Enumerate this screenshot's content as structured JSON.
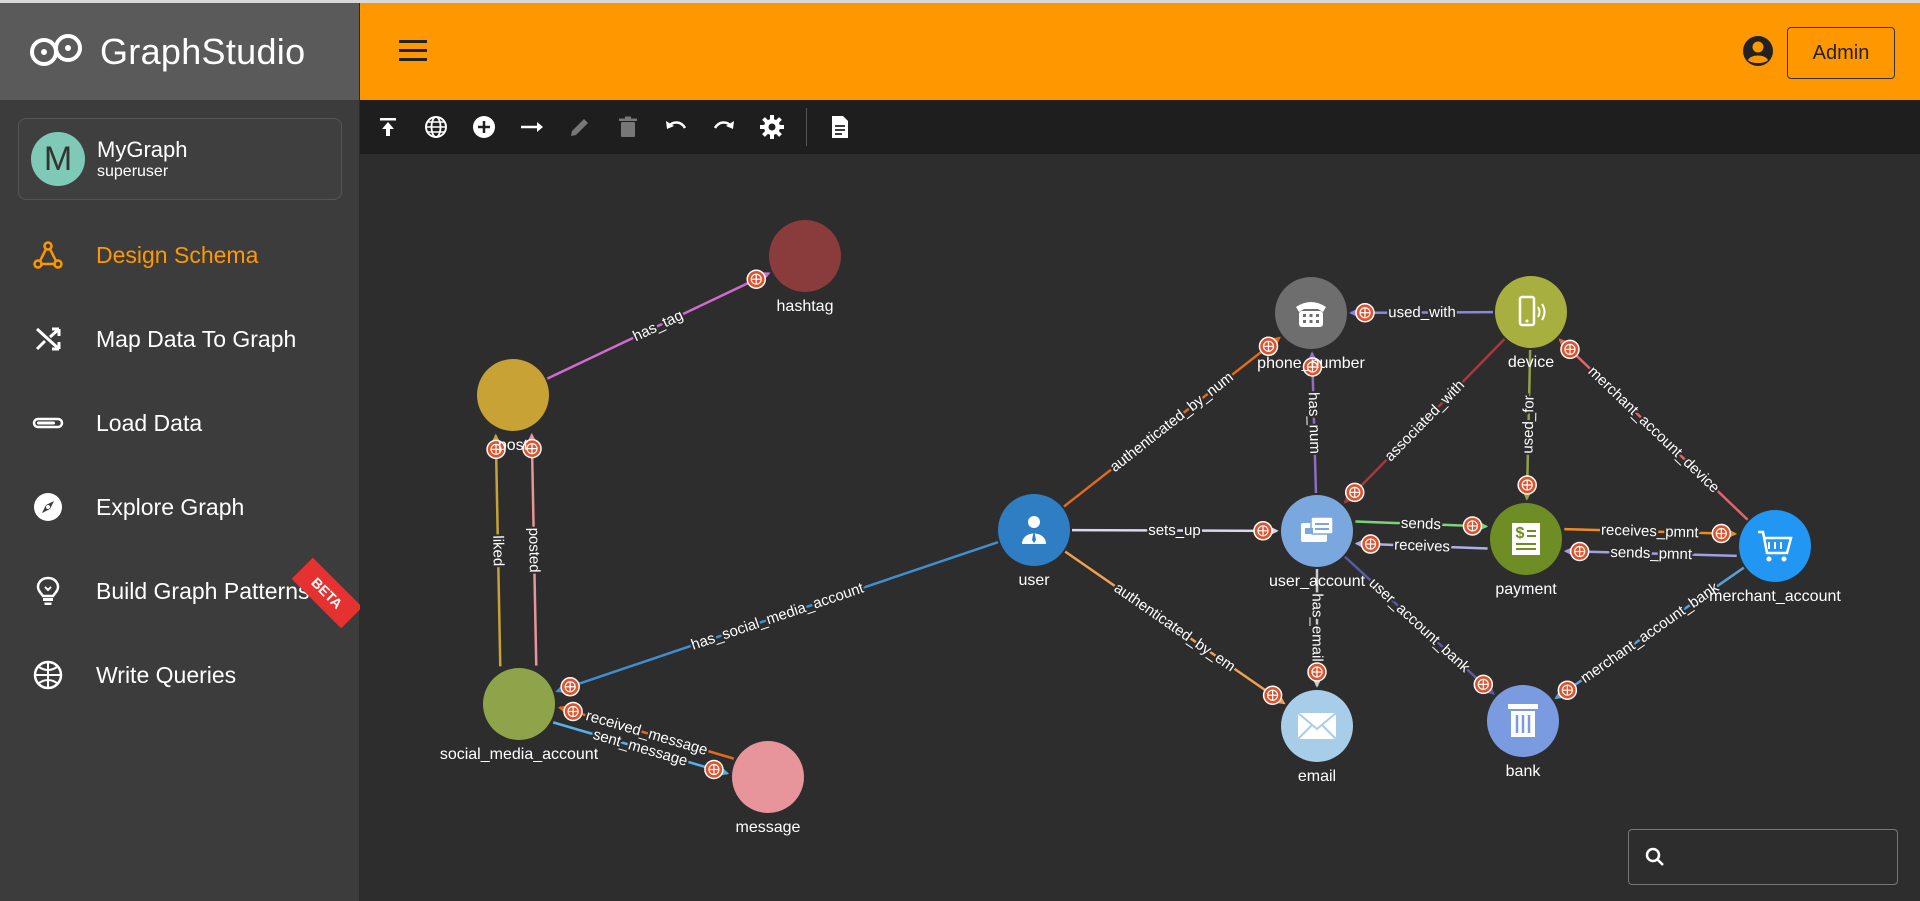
{
  "app": {
    "logo_text": "GraphStudio",
    "accent": "#ff9800"
  },
  "sidebar": {
    "graph": {
      "initial": "M",
      "name": "MyGraph",
      "user": "superuser"
    },
    "items": [
      {
        "label": "Design Schema",
        "icon": "schema-icon",
        "active": true
      },
      {
        "label": "Map Data To Graph",
        "icon": "shuffle-icon"
      },
      {
        "label": "Load Data",
        "icon": "load-bar-icon"
      },
      {
        "label": "Explore Graph",
        "icon": "compass-icon"
      },
      {
        "label": "Build Graph Patterns",
        "icon": "lightbulb-icon"
      },
      {
        "label": "Write Queries",
        "icon": "globe-grid-icon"
      }
    ],
    "beta_label": "BETA"
  },
  "header": {
    "menu_icon": "hamburger-icon",
    "user_icon": "account-circle-icon",
    "admin_label": "Admin"
  },
  "toolbar": {
    "items": [
      "publish-icon",
      "globe-icon",
      "add-vertex-icon",
      "add-edge-icon",
      "edit-icon",
      "delete-icon",
      "undo-icon",
      "redo-icon",
      "settings-icon",
      "document-icon"
    ]
  },
  "graph": {
    "vertices": [
      {
        "id": "hashtag",
        "label": "hashtag",
        "color": "#8a3b3b"
      },
      {
        "id": "post",
        "label": "post",
        "color": "#c9a235"
      },
      {
        "id": "social_media_account",
        "label": "social_media_account",
        "color": "#8fa44a"
      },
      {
        "id": "message",
        "label": "message",
        "color": "#e8949b"
      },
      {
        "id": "user",
        "label": "user",
        "color": "#2f7ec4",
        "icon": "person-icon"
      },
      {
        "id": "phone_number",
        "label": "phone_number",
        "color": "#6e6e6e",
        "icon": "telephone-icon"
      },
      {
        "id": "device",
        "label": "device",
        "color": "#a7b03f",
        "icon": "mobile-device-icon"
      },
      {
        "id": "user_account",
        "label": "user_account",
        "color": "#7aa7de",
        "icon": "id-card-icon"
      },
      {
        "id": "payment",
        "label": "payment",
        "color": "#6e8e25",
        "icon": "invoice-icon"
      },
      {
        "id": "merchant_account",
        "label": "merchant_account",
        "color": "#2196f3",
        "icon": "cart-icon"
      },
      {
        "id": "email",
        "label": "email",
        "color": "#a8cde8",
        "icon": "envelope-icon"
      },
      {
        "id": "bank",
        "label": "bank",
        "color": "#7b9be0",
        "icon": "bank-icon"
      }
    ],
    "edges": [
      {
        "label": "has_tag",
        "color": "#d06bd0"
      },
      {
        "label": "liked",
        "color": "#c9a235"
      },
      {
        "label": "posted",
        "color": "#e8949b"
      },
      {
        "label": "has_social_media_account",
        "color": "#3f8ed0"
      },
      {
        "label": "sent_message",
        "color": "#57b0e6"
      },
      {
        "label": "received_message",
        "color": "#e06a1f"
      },
      {
        "label": "authenticated_by_num",
        "color": "#e06a1f"
      },
      {
        "label": "sets_up",
        "color": "#d8d8f0"
      },
      {
        "label": "authenticated_by_em",
        "color": "#f0a050"
      },
      {
        "label": "used_with",
        "color": "#8888dd"
      },
      {
        "label": "has_num",
        "color": "#8d6fbf"
      },
      {
        "label": "associated_with",
        "color": "#a8393a"
      },
      {
        "label": "used_for",
        "color": "#93a04a"
      },
      {
        "label": "merchant_account_device",
        "color": "#e06666"
      },
      {
        "label": "sends",
        "color": "#7bd37b"
      },
      {
        "label": "receives",
        "color": "#b0b0e8"
      },
      {
        "label": "receives_pmnt",
        "color": "#f08a1d"
      },
      {
        "label": "sends_pmnt",
        "color": "#a0a0e0"
      },
      {
        "label": "has_email",
        "color": "#cccccc"
      },
      {
        "label": "user_account_bank",
        "color": "#5a5aa8"
      },
      {
        "label": "merchant_account_bank",
        "color": "#5aa0d8"
      }
    ],
    "edge_badge_icon": "globe-badge-icon"
  },
  "search": {
    "icon": "search-icon",
    "placeholder": ""
  }
}
